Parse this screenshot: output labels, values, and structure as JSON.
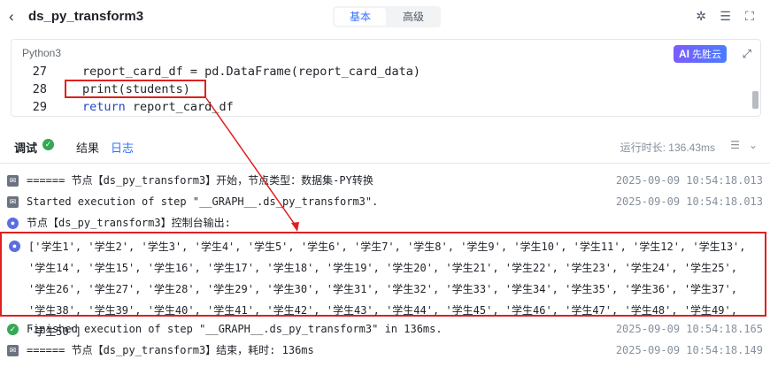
{
  "header": {
    "back_icon": "back-arrow-icon",
    "title": "ds_py_transform3",
    "modes": [
      "基本",
      "高级"
    ],
    "icons": [
      "bug-icon",
      "list-settings-icon",
      "fullscreen-icon"
    ]
  },
  "editor": {
    "language": "Python3",
    "ai_badge": "AI",
    "ai_label": "先胜云",
    "lines": [
      {
        "no": "27",
        "code": "report_card_df = pd.DataFrame(report_card_data)"
      },
      {
        "no": "28",
        "code": "print(students)"
      },
      {
        "no": "29",
        "code_kw": "return",
        "code": " report_card_df"
      }
    ]
  },
  "panel": {
    "tabs": [
      "调试",
      "结果",
      "日志"
    ],
    "active_tab": "日志",
    "runtime": "运行时长: 136.43ms"
  },
  "logs": [
    {
      "icon": "mail-icon",
      "text": "====== 节点【ds_py_transform3】开始，节点类型：数据集-PY转换",
      "time": "2025-09-09 10:54:18.013"
    },
    {
      "icon": "mail-icon",
      "text": "Started execution of step \"__GRAPH__.ds_py_transform3\".",
      "time": "2025-09-09 10:54:18.013"
    },
    {
      "icon": "user-icon",
      "text": "节点【ds_py_transform3】控制台输出:",
      "time": ""
    },
    {
      "icon": "check-icon",
      "text": "Finished execution of step \"__GRAPH__.ds_py_transform3\" in 136ms.",
      "time": "2025-09-09 10:54:18.165"
    },
    {
      "icon": "mail-icon",
      "text": "====== 节点【ds_py_transform3】结束，耗时: 136ms",
      "time": "2025-09-09 10:54:18.149"
    }
  ],
  "output": {
    "icon": "user-icon",
    "text": "['学生1', '学生2', '学生3', '学生4', '学生5', '学生6', '学生7', '学生8', '学生9', '学生10', '学生11', '学生12', '学生13', '学生14', '学生15', '学生16', '学生17', '学生18', '学生19', '学生20', '学生21', '学生22', '学生23', '学生24', '学生25', '学生26', '学生27', '学生28', '学生29', '学生30', '学生31', '学生32', '学生33', '学生34', '学生35', '学生36', '学生37', '学生38', '学生39', '学生40', '学生41', '学生42', '学生43', '学生44', '学生45', '学生46', '学生47', '学生48', '学生49', '学生50']"
  },
  "colors": {
    "accent": "#3370ff",
    "highlight": "#e02020",
    "success": "#34a853"
  }
}
